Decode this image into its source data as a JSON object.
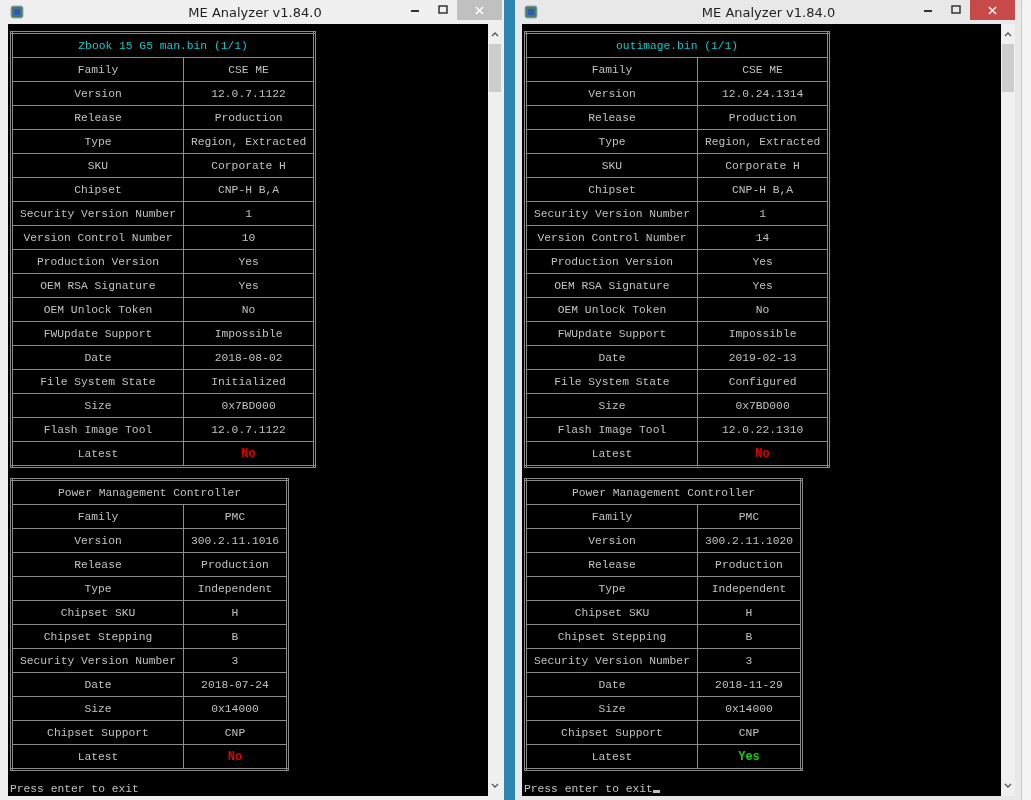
{
  "windows": [
    {
      "title": "ME Analyzer v1.84.0",
      "active": false,
      "cursor": false,
      "prompt": "Press enter to exit",
      "tables": [
        {
          "title": "Zbook 15 G5 man.bin (1/1)",
          "rows": [
            {
              "label": "Family",
              "value": "CSE ME"
            },
            {
              "label": "Version",
              "value": "12.0.7.1122"
            },
            {
              "label": "Release",
              "value": "Production"
            },
            {
              "label": "Type",
              "value": "Region, Extracted"
            },
            {
              "label": "SKU",
              "value": "Corporate H"
            },
            {
              "label": "Chipset",
              "value": "CNP-H B,A"
            },
            {
              "label": "Security Version Number",
              "value": "1"
            },
            {
              "label": "Version Control Number",
              "value": "10"
            },
            {
              "label": "Production Version",
              "value": "Yes"
            },
            {
              "label": "OEM RSA Signature",
              "value": "Yes"
            },
            {
              "label": "OEM Unlock Token",
              "value": "No"
            },
            {
              "label": "FWUpdate Support",
              "value": "Impossible"
            },
            {
              "label": "Date",
              "value": "2018-08-02"
            },
            {
              "label": "File System State",
              "value": "Initialized"
            },
            {
              "label": "Size",
              "value": "0x7BD000"
            },
            {
              "label": "Flash Image Tool",
              "value": "12.0.7.1122"
            },
            {
              "label": "Latest",
              "value": "No",
              "color": "#e00000"
            }
          ]
        },
        {
          "title": "Power Management Controller",
          "rows": [
            {
              "label": "Family",
              "value": "PMC"
            },
            {
              "label": "Version",
              "value": "300.2.11.1016"
            },
            {
              "label": "Release",
              "value": "Production"
            },
            {
              "label": "Type",
              "value": "Independent"
            },
            {
              "label": "Chipset SKU",
              "value": "H"
            },
            {
              "label": "Chipset Stepping",
              "value": "B"
            },
            {
              "label": "Security Version Number",
              "value": "3"
            },
            {
              "label": "Date",
              "value": "2018-07-24"
            },
            {
              "label": "Size",
              "value": "0x14000"
            },
            {
              "label": "Chipset Support",
              "value": "CNP"
            },
            {
              "label": "Latest",
              "value": "No",
              "color": "#e00000"
            }
          ]
        }
      ]
    },
    {
      "title": "ME Analyzer v1.84.0",
      "active": true,
      "cursor": true,
      "prompt": "Press enter to exit",
      "tables": [
        {
          "title": "outimage.bin (1/1)",
          "rows": [
            {
              "label": "Family",
              "value": "CSE ME"
            },
            {
              "label": "Version",
              "value": "12.0.24.1314"
            },
            {
              "label": "Release",
              "value": "Production"
            },
            {
              "label": "Type",
              "value": "Region, Extracted"
            },
            {
              "label": "SKU",
              "value": "Corporate H"
            },
            {
              "label": "Chipset",
              "value": "CNP-H B,A"
            },
            {
              "label": "Security Version Number",
              "value": "1"
            },
            {
              "label": "Version Control Number",
              "value": "14"
            },
            {
              "label": "Production Version",
              "value": "Yes"
            },
            {
              "label": "OEM RSA Signature",
              "value": "Yes"
            },
            {
              "label": "OEM Unlock Token",
              "value": "No"
            },
            {
              "label": "FWUpdate Support",
              "value": "Impossible"
            },
            {
              "label": "Date",
              "value": "2019-02-13"
            },
            {
              "label": "File System State",
              "value": "Configured"
            },
            {
              "label": "Size",
              "value": "0x7BD000"
            },
            {
              "label": "Flash Image Tool",
              "value": "12.0.22.1310"
            },
            {
              "label": "Latest",
              "value": "No",
              "color": "#e00000"
            }
          ]
        },
        {
          "title": "Power Management Controller",
          "rows": [
            {
              "label": "Family",
              "value": "PMC"
            },
            {
              "label": "Version",
              "value": "300.2.11.1020"
            },
            {
              "label": "Release",
              "value": "Production"
            },
            {
              "label": "Type",
              "value": "Independent"
            },
            {
              "label": "Chipset SKU",
              "value": "H"
            },
            {
              "label": "Chipset Stepping",
              "value": "B"
            },
            {
              "label": "Security Version Number",
              "value": "3"
            },
            {
              "label": "Date",
              "value": "2018-11-29"
            },
            {
              "label": "Size",
              "value": "0x14000"
            },
            {
              "label": "Chipset Support",
              "value": "CNP"
            },
            {
              "label": "Latest",
              "value": "Yes",
              "color": "#10d010"
            }
          ]
        }
      ]
    }
  ]
}
